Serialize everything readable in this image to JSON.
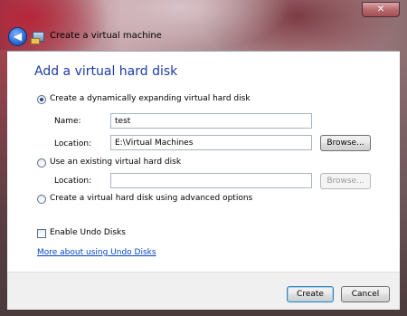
{
  "window": {
    "title": "Create a virtual machine",
    "close_glyph": "✕",
    "back_glyph": "◀",
    "icons": [
      "back-arrow-icon",
      "virtual-machine-icon",
      "close-icon"
    ]
  },
  "page": {
    "heading": "Add a virtual hard disk",
    "options": {
      "dynamic": {
        "label": "Create a dynamically expanding virtual hard disk",
        "selected": true,
        "name_label": "Name:",
        "name_value": "test",
        "location_label": "Location:",
        "location_value": "E:\\Virtual Machines",
        "browse_label": "Browse..."
      },
      "existing": {
        "label": "Use an existing virtual hard disk",
        "selected": false,
        "location_label": "Location:",
        "location_value": "",
        "browse_label": "Browse..."
      },
      "advanced": {
        "label": "Create a virtual hard disk using advanced options",
        "selected": false
      }
    },
    "undo": {
      "label": "Enable Undo Disks",
      "checked": false,
      "link": "More about using Undo Disks"
    }
  },
  "footer": {
    "create_label": "Create",
    "cancel_label": "Cancel"
  }
}
